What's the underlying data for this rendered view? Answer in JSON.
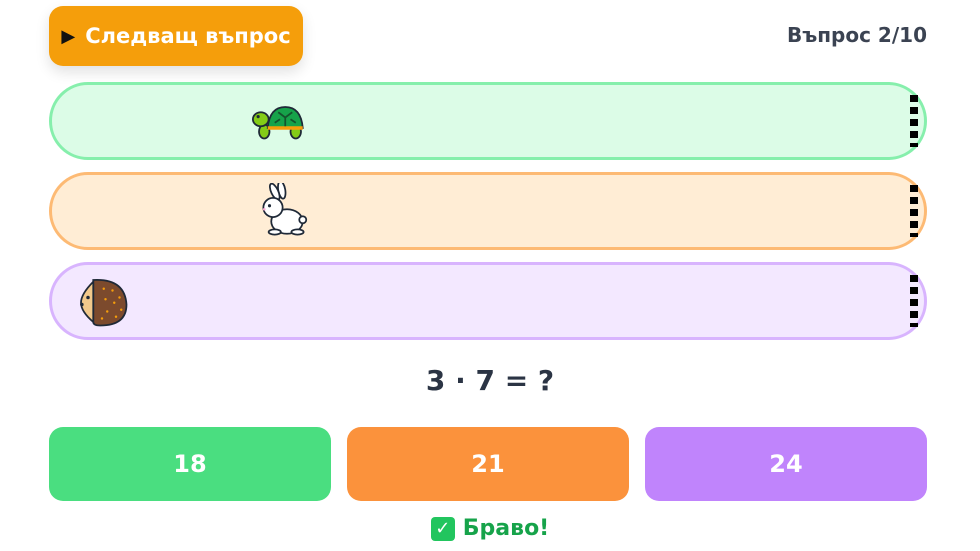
{
  "toolbar": {
    "next_label": "Следващ въпрос",
    "play_icon": "▶"
  },
  "counter": "Въпрос 2/10",
  "lanes": [
    {
      "animal": "turtle",
      "progress": 0.24,
      "color": "#dcfce7"
    },
    {
      "animal": "rabbit",
      "progress": 0.24,
      "color": "#ffedd5"
    },
    {
      "animal": "hedgehog",
      "progress": 0.0,
      "color": "#f3e8ff"
    }
  ],
  "question": "3 · 7 = ?",
  "answers": [
    "18",
    "21",
    "24"
  ],
  "feedback": {
    "icon": "✓",
    "text": "Браво!"
  },
  "colors": {
    "accent": "#f59e0b",
    "green": "#4ade80",
    "orange": "#fb923c",
    "purple": "#c084fc",
    "success": "#16a34a"
  }
}
